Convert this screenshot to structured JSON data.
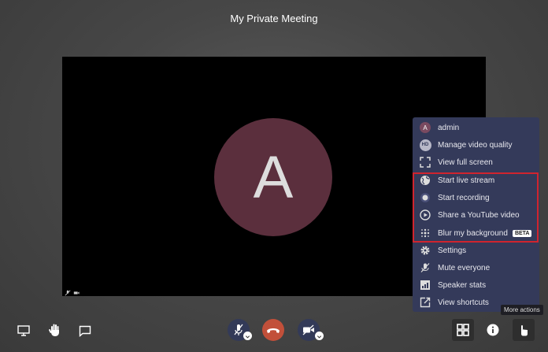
{
  "meeting": {
    "title": "My Private Meeting",
    "participant_initial": "A"
  },
  "menu": {
    "items": [
      {
        "label": "admin",
        "icon": "avatar",
        "initial": "A"
      },
      {
        "label": "Manage video quality",
        "icon": "hd-icon",
        "badge": "HD"
      },
      {
        "label": "View full screen",
        "icon": "fullscreen-icon"
      },
      {
        "label": "Start live stream",
        "icon": "globe-icon"
      },
      {
        "label": "Start recording",
        "icon": "record-icon"
      },
      {
        "label": "Share a YouTube video",
        "icon": "play-icon"
      },
      {
        "label": "Blur my background",
        "icon": "blur-icon",
        "badge": "BETA"
      },
      {
        "label": "Settings",
        "icon": "gear-icon"
      },
      {
        "label": "Mute everyone",
        "icon": "mute-all-icon"
      },
      {
        "label": "Speaker stats",
        "icon": "stats-icon"
      },
      {
        "label": "View shortcuts",
        "icon": "shortcut-icon"
      }
    ]
  },
  "tooltip": "More actions",
  "colors": {
    "menu_bg": "#343a5a",
    "hangup": "#c2503a",
    "highlight": "#d0242e",
    "avatar": "#5b2f3d"
  }
}
